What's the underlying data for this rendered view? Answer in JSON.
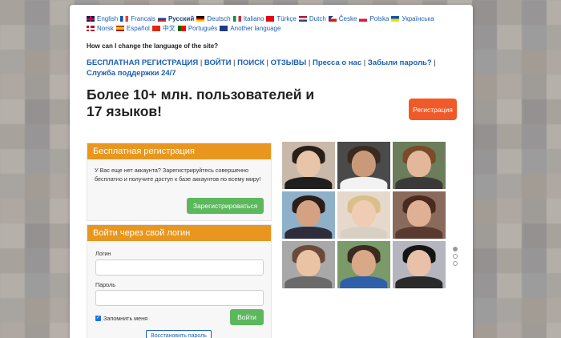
{
  "languages": [
    {
      "label": "English",
      "flag": "en",
      "active": false
    },
    {
      "label": "Francais",
      "flag": "fr",
      "active": false
    },
    {
      "label": "Русский",
      "flag": "ru",
      "active": true
    },
    {
      "label": "Deutsch",
      "flag": "de",
      "active": false
    },
    {
      "label": "Italiano",
      "flag": "it",
      "active": false
    },
    {
      "label": "Türkçe",
      "flag": "tr",
      "active": false
    },
    {
      "label": "Dutch",
      "flag": "nl",
      "active": false
    },
    {
      "label": "Česke",
      "flag": "cz",
      "active": false
    },
    {
      "label": "Polska",
      "flag": "pl",
      "active": false
    },
    {
      "label": "Українська",
      "flag": "ua",
      "active": false
    },
    {
      "label": "Norsk",
      "flag": "no",
      "active": false
    },
    {
      "label": "Español",
      "flag": "es",
      "active": false
    },
    {
      "label": "中文",
      "flag": "cn",
      "active": false
    },
    {
      "label": "Português",
      "flag": "pt",
      "active": false
    },
    {
      "label": "Another language",
      "flag": "other",
      "active": false
    }
  ],
  "language_question": "How can I change the language of the site?",
  "nav": {
    "free_registration": "БЕСПЛАТНАЯ РЕГИСТРАЦИЯ",
    "login": "ВОЙТИ",
    "search": "ПОИСК",
    "reviews": "ОТЗЫВЫ",
    "press": "Пресса о нас",
    "forgot_password": "Забыли пароль?",
    "support": "Служба поддержки 24/7",
    "separator": "|"
  },
  "headline": "Более 10+ млн. пользователей и 17 языков!",
  "register_top_button": "Регистрация",
  "free_registration_box": {
    "title": "Бесплатная регистрация",
    "text": "У Вас еще нет аккаунта? Зарегистрируйтесь совершенно бесплатно и получите доступ к базе аккаунтов по всему миру!",
    "button": "Зарегистрироваться"
  },
  "login_box": {
    "title": "Войти через свой логин",
    "login_label": "Логин",
    "login_value": "",
    "password_label": "Пароль",
    "password_value": "",
    "remember_label": "Запомнить меня",
    "remember_checked": true,
    "submit": "Войти",
    "restore": "Восстановить пароль"
  },
  "photo_grid": {
    "items": [
      {
        "name": "woman-dark-hair",
        "bg": "#c9b9aa",
        "skin": "#e8c4a8",
        "hair": "#2a1e18",
        "shirt": "#1f1f1f"
      },
      {
        "name": "man-white-shirt",
        "bg": "#4a4a4a",
        "skin": "#c99a7a",
        "hair": "#3a2a20",
        "shirt": "#f2f2f2"
      },
      {
        "name": "woman-smiling",
        "bg": "#6b7d5a",
        "skin": "#e3b79a",
        "hair": "#7a4a2a",
        "shirt": "#3a3a3a"
      },
      {
        "name": "man-sunglasses",
        "bg": "#8fb0c9",
        "skin": "#d4a282",
        "hair": "#2a1e18",
        "shirt": "#2e2e3a"
      },
      {
        "name": "woman-blonde",
        "bg": "#e6d9cc",
        "skin": "#f0ccb5",
        "hair": "#d9c08a",
        "shirt": "#d9d0c4"
      },
      {
        "name": "woman-brunette",
        "bg": "#8a6a5a",
        "skin": "#e0b094",
        "hair": "#4a2a1e",
        "shirt": "#5a3a30"
      },
      {
        "name": "woman-beanie",
        "bg": "#a8a8a8",
        "skin": "#eac3a5",
        "hair": "#6b4a3a",
        "shirt": "#6a6a6a"
      },
      {
        "name": "man-blue-shirt",
        "bg": "#7a9a6a",
        "skin": "#d9a888",
        "hair": "#3a2a20",
        "shirt": "#2f5fa8"
      },
      {
        "name": "woman-black-hair",
        "bg": "#b5b5c0",
        "skin": "#e9c0a8",
        "hair": "#141414",
        "shirt": "#2a2a2a"
      }
    ]
  },
  "carousel": {
    "count": 3,
    "active_index": 0
  },
  "colors": {
    "orange_header": "#e8961e",
    "register_button": "#f05a28",
    "green_button": "#5cb85c",
    "link_blue": "#1a5fb4"
  }
}
